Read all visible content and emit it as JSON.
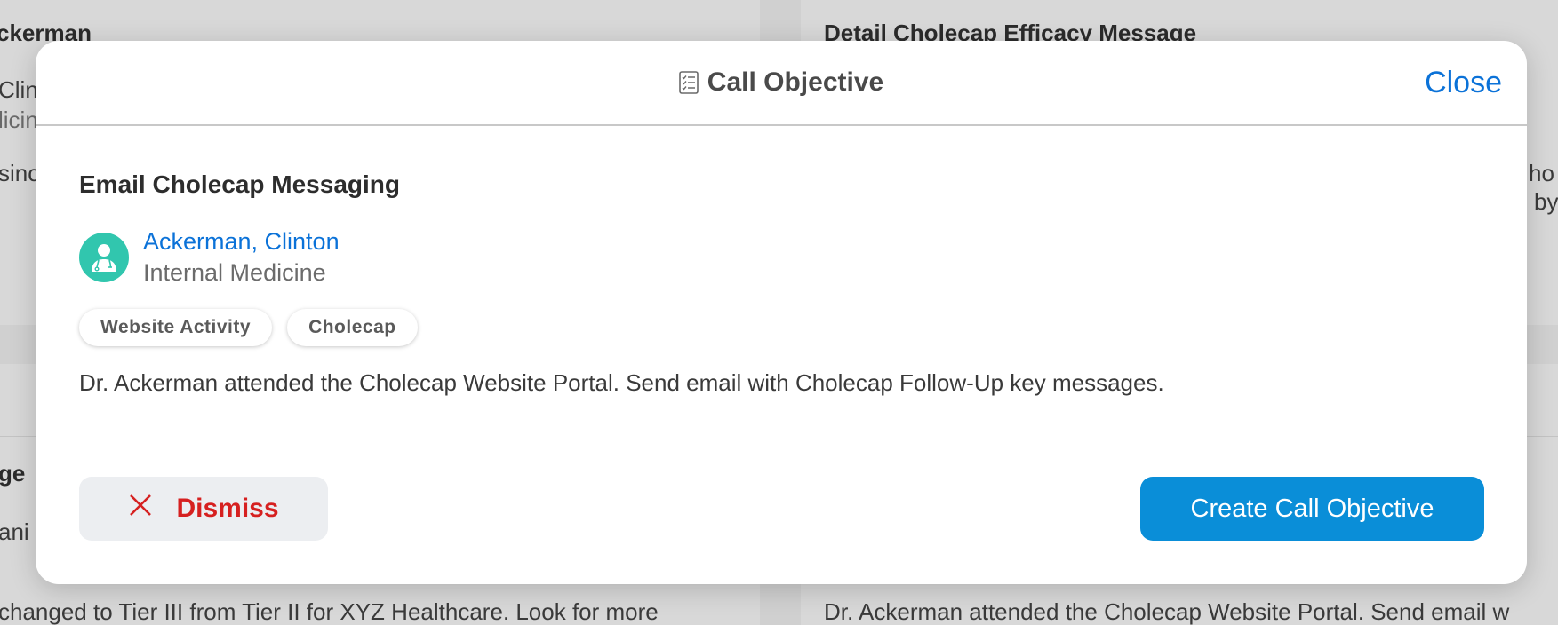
{
  "background": {
    "left_title": "ckerman",
    "left_line1": "Clint",
    "left_line2": "licin",
    "left_line3": "sinc",
    "left_mid": "ge",
    "left_mid2": "ani",
    "left_bottom": " changed to Tier III from Tier II for XYZ Healthcare. Look for more",
    "right_title": "Detail Cholecap Efficacy Message",
    "right_line1": "ho",
    "right_line2": "by",
    "right_bottom": "Dr. Ackerman attended the Cholecap Website Portal. Send email w"
  },
  "modal": {
    "title": "Call Objective",
    "title_icon": "checklist-icon",
    "close_label": "Close",
    "objective_title": "Email Cholecap Messaging",
    "contact": {
      "name": "Ackerman, Clinton",
      "specialty": "Internal Medicine",
      "avatar_icon": "doctor-avatar-icon"
    },
    "tags": [
      "Website Activity",
      "Cholecap"
    ],
    "description": "Dr. Ackerman attended the Cholecap Website Portal. Send email with Cholecap Follow-Up key messages.",
    "dismiss_label": "Dismiss",
    "dismiss_icon": "close-x-icon",
    "create_label": "Create Call Objective"
  },
  "colors": {
    "accent_blue": "#0b72d8",
    "button_blue": "#0a8ed8",
    "dismiss_red": "#d62020",
    "avatar_teal": "#31c6ae"
  }
}
